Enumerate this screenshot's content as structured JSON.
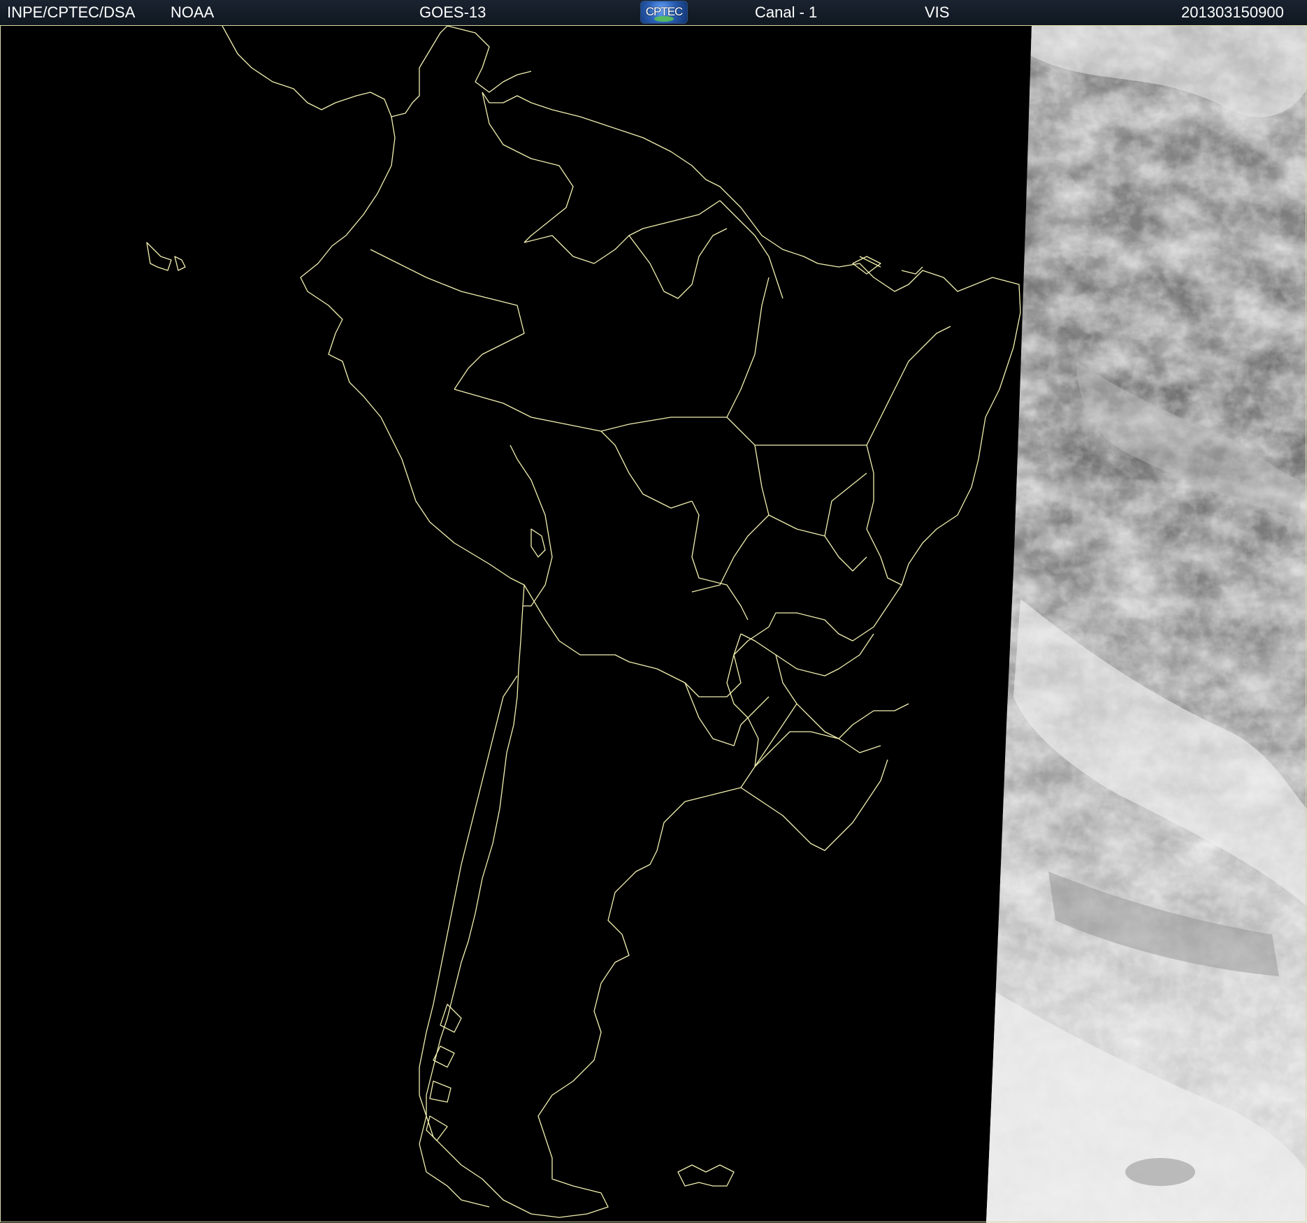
{
  "header": {
    "organization": "INPE/CPTEC/DSA",
    "agency": "NOAA",
    "satellite": "GOES-13",
    "logo_text": "CPTEC",
    "channel": "Canal - 1",
    "band": "VIS",
    "timestamp": "201303150900"
  },
  "map": {
    "background_color": "#000000",
    "boundary_color": "#f2f0b0",
    "cloud_region": "east (daylit Atlantic)",
    "night_region": "west"
  }
}
